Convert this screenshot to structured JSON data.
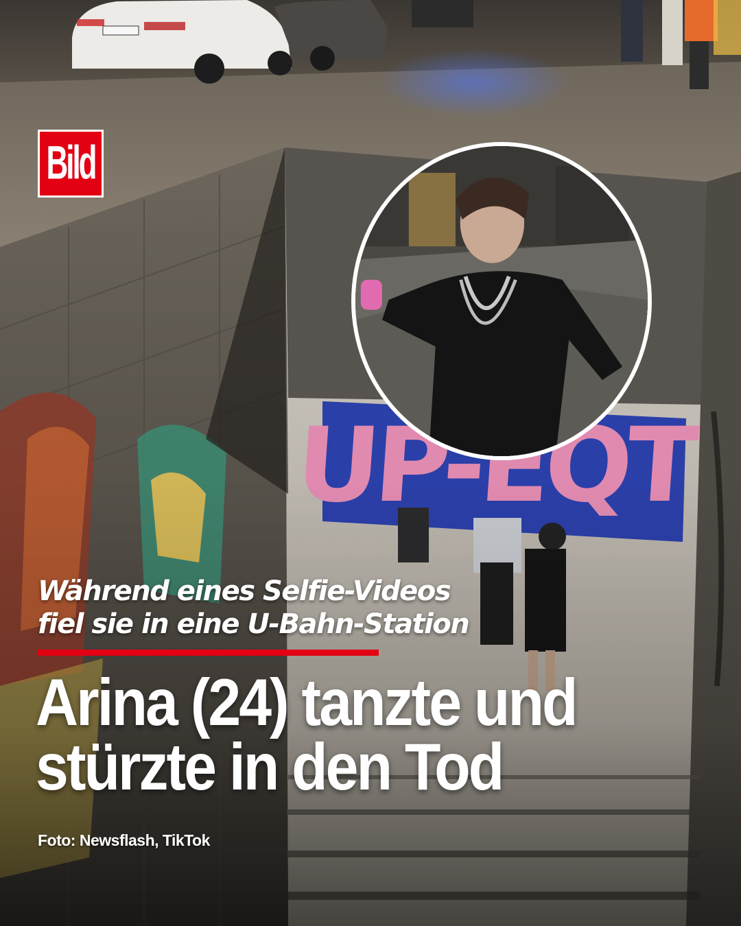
{
  "brand": {
    "logo_text": "Bild",
    "color": "#e30013"
  },
  "photo": {
    "scene": "underground-entrance-night",
    "inset": "selfie-video-frame"
  },
  "article": {
    "kicker_line1": "Während eines Selfie-Videos",
    "kicker_line2": "fiel sie in eine U-Bahn-Station",
    "headline_line1": "Arina (24) tanzte und",
    "headline_line2": "stürzte in den Tod",
    "credit": "Foto: Newsflash, TikTok"
  },
  "graffiti_text": "UP-EQT"
}
